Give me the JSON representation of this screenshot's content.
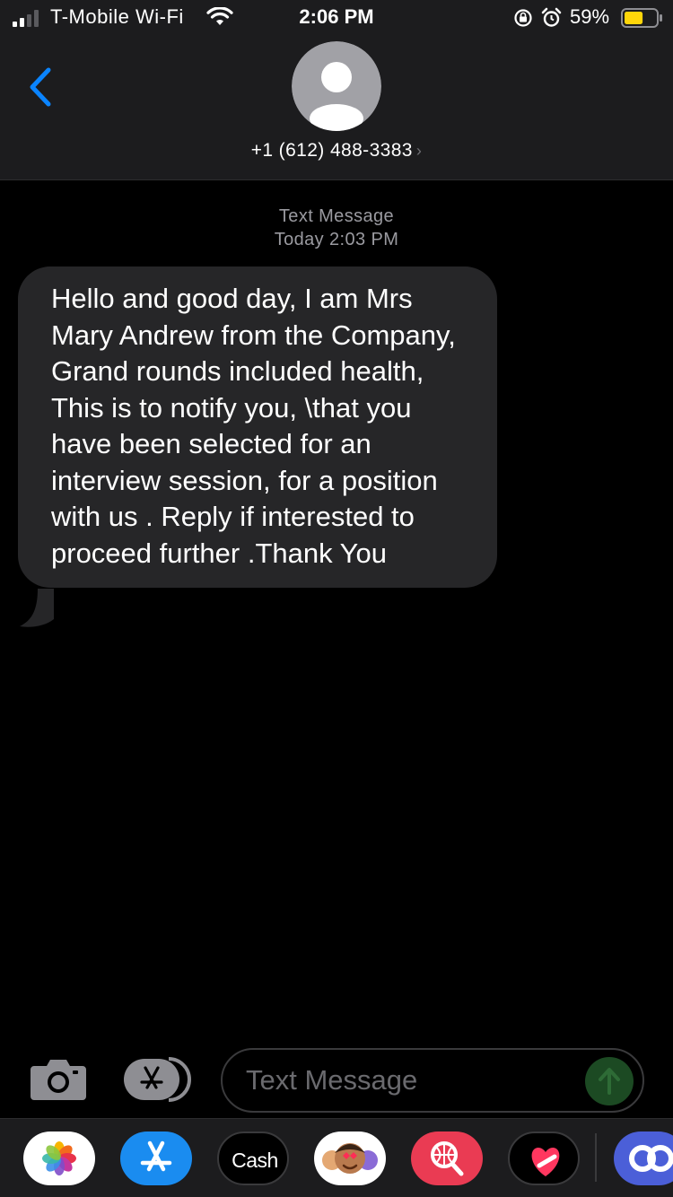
{
  "status_bar": {
    "carrier": "T-Mobile Wi-Fi",
    "time": "2:06 PM",
    "battery_percent": "59%",
    "battery_level": 0.59,
    "signal_bars": 2,
    "icons": [
      "signal-icon",
      "wifi-icon",
      "rotation-lock-icon",
      "alarm-icon",
      "battery-icon"
    ]
  },
  "header": {
    "contact": "+1 (612) 488-3383",
    "contact_chevron": "›",
    "icons": [
      "back-chevron-icon",
      "contact-avatar-icon"
    ]
  },
  "thread": {
    "service_label": "Text Message",
    "timestamp": "Today 2:03 PM",
    "messages": [
      {
        "direction": "incoming",
        "text": "Hello and good day, I am Mrs Mary Andrew  from the Company, Grand rounds included health, This is to notify you, \\that you have been selected for an interview session, for a position with us . Reply if interested to proceed further .Thank You"
      }
    ]
  },
  "composer": {
    "placeholder": "Text Message",
    "icons": [
      "camera-icon",
      "app-store-icon",
      "send-arrow-icon"
    ]
  },
  "app_drawer": {
    "apps": [
      {
        "name": "photos-app-icon"
      },
      {
        "name": "app-store-app-icon"
      },
      {
        "name": "apple-cash-app-icon",
        "label": "Cash"
      },
      {
        "name": "memoji-app-icon"
      },
      {
        "name": "web-image-search-app-icon"
      },
      {
        "name": "digital-touch-app-icon"
      },
      {
        "name": "partial-app-icon"
      }
    ]
  },
  "colors": {
    "background": "#000000",
    "header": "#1c1c1e",
    "incoming_bubble": "#262628",
    "accent_blue": "#0a84ff",
    "battery_fill": "#ffd60a",
    "meta_text": "#9a9aa0"
  }
}
